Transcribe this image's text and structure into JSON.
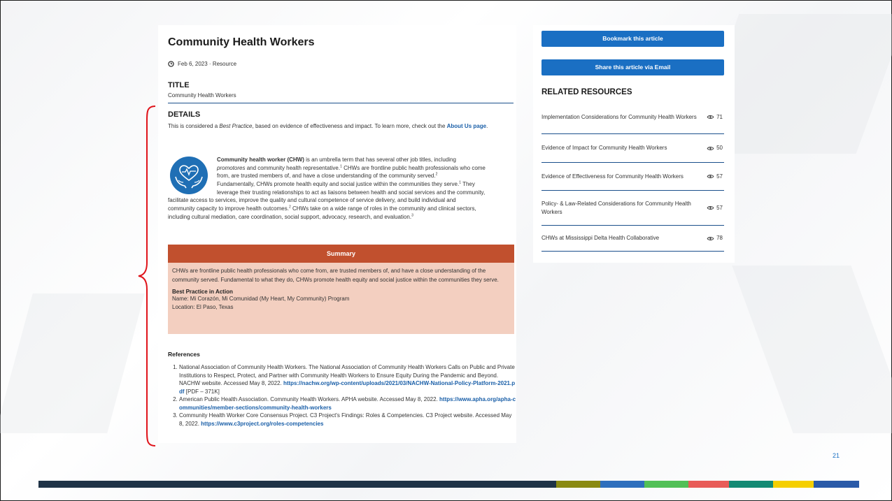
{
  "article": {
    "title": "Community Health Workers",
    "date": "Feb 6, 2023",
    "type": "Resource",
    "title_label": "TITLE",
    "title_value": "Community Health Workers",
    "details_label": "DETAILS",
    "details_intro_1": "This is considered a ",
    "details_intro_em": "Best Practice",
    "details_intro_2": ", based on evidence of effectiveness and impact. To learn more, check out the ",
    "details_link": "About Us page",
    "details_intro_end": ".",
    "chw_term": "Community health worker (CHW)",
    "chw_l1_rest": " is an umbrella term that has several other job titles, including",
    "chw_l2_em": "promotores",
    "chw_l2_rest": " and community health representative.",
    "sup1": "1",
    "chw_l2_rest2": " CHWs are frontline public health professionals who come",
    "chw_l3": "from, are trusted members of, and have a close understanding of the community served.",
    "sup2": "2",
    "chw_l4": "Fundamentally, CHWs promote health equity and social justice within the communities they serve.",
    "sup3": "1",
    "chw_l4_rest": " They",
    "chw_l5": "leverage their trusting relationships to act as liaisons between health and social services and the community,",
    "chw_l6": "facilitate access to services, improve the quality and cultural competence of service delivery, and build individual and",
    "chw_l7": "community capacity to improve health outcomes.",
    "sup4": "2",
    "chw_l7_rest": " CHWs take on a wide range of roles in the community and clinical sectors,",
    "chw_l8": "including cultural mediation, care coordination, social support, advocacy, research, and evaluation.",
    "sup5": "3",
    "summary_label": "Summary",
    "summary_text": "CHWs are frontline public health professionals who come from, are trusted members of, and have a close understanding of the community served. Fundamental to what they do, CHWs promote health equity and social justice within the communities they serve.",
    "bp_label": "Best Practice in Action",
    "bp_name": "Name: Mi Corazón, Mi Comunidad (My Heart, My Community) Program",
    "bp_location": "Location: El Paso, Texas",
    "references_label": "References",
    "references": [
      {
        "text": "National Association of Community Health Workers. The National Association of Community Health Workers Calls on Public and Private Institutions to Respect, Protect, and Partner with Community Health Workers to Ensure Equity During the Pandemic and Beyond. NACHW website. Accessed May 8, 2022. ",
        "link": "https://nachw.org/wp-content/uploads/2021/03/NACHW-National-Policy-Platform-2021.pdf",
        "suffix": " [PDF – 371K]"
      },
      {
        "text": "American Public Health Association. Community Health Workers. APHA website. Accessed May 8, 2022. ",
        "link": "https://www.apha.org/apha-communities/member-sections/community-health-workers",
        "suffix": ""
      },
      {
        "text": "Community Health Worker Core Consensus Project. C3 Project's Findings: Roles & Competencies. C3 Project website. Accessed May 8, 2022. ",
        "link": "https://www.c3project.org/roles-competencies",
        "suffix": ""
      }
    ]
  },
  "sidebar": {
    "bookmark_label": "Bookmark this article",
    "share_label": "Share this article via Email",
    "related_title": "RELATED RESOURCES",
    "related": [
      {
        "title": "Implementation Considerations for Community Health Workers",
        "views": "71"
      },
      {
        "title": "Evidence of Impact for Community Health Workers",
        "views": "50"
      },
      {
        "title": "Evidence of Effectiveness for Community Health Workers",
        "views": "57"
      },
      {
        "title": "Policy- & Law-Related Considerations for Community Health Workers",
        "views": "57"
      },
      {
        "title": "CHWs at Mississippi Delta Health Collaborative",
        "views": "78"
      }
    ]
  },
  "slide": {
    "page_number": "21",
    "accent_colors": [
      "#1f3347",
      "#8a8a12",
      "#2e6fbd",
      "#52c057",
      "#e85c58",
      "#138a74",
      "#f5cf00",
      "#2a5aa8"
    ]
  }
}
